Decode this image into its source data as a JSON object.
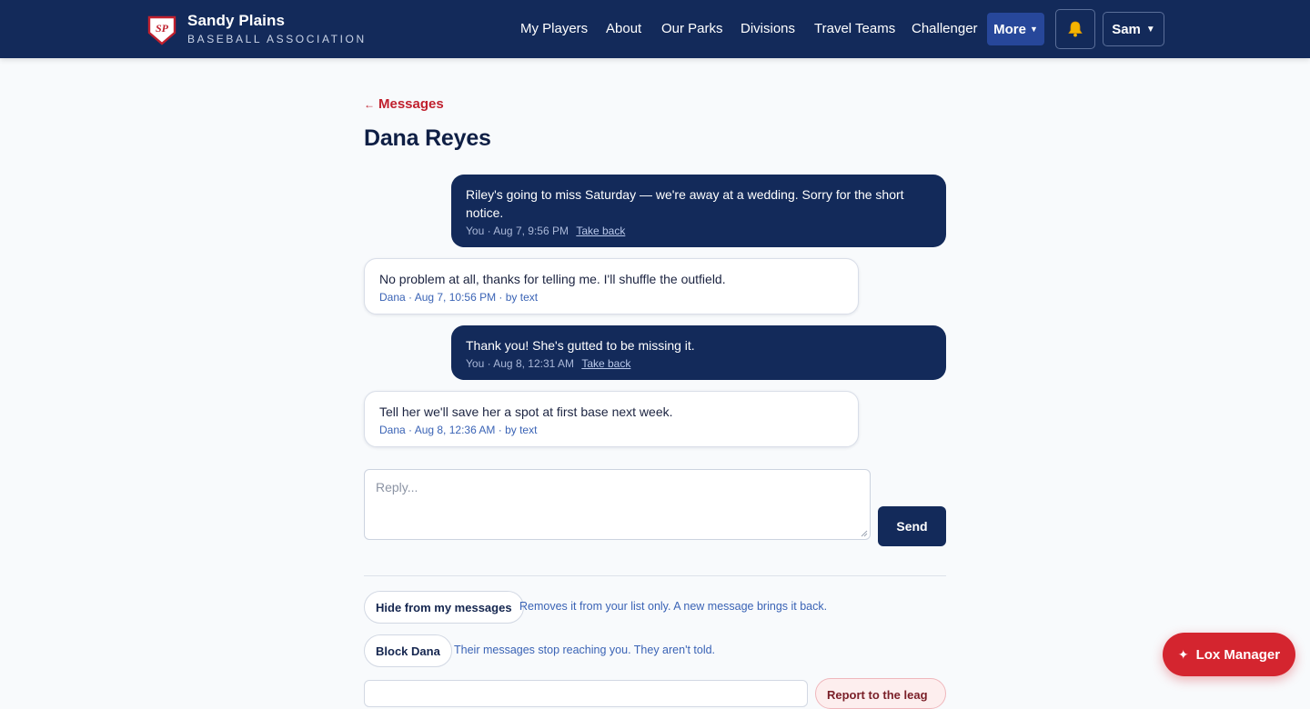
{
  "header": {
    "brand_title": "Sandy Plains",
    "brand_subtitle": "BASEBALL ASSOCIATION",
    "logo_initials": "SP",
    "nav": [
      "My Players",
      "About",
      "Our Parks",
      "Divisions",
      "Travel Teams",
      "Challenger"
    ],
    "more_label": "More",
    "user_label": "Sam",
    "bell_icon": "bell-icon"
  },
  "conversation": {
    "back_label": "Messages",
    "title": "Dana Reyes",
    "messages": [
      {
        "direction": "out",
        "text": "Riley's going to miss Saturday — we're away at a wedding. Sorry for the short notice.",
        "meta": "You · Aug 7, 9:56 PM",
        "action": "Take back"
      },
      {
        "direction": "in",
        "text": "No problem at all, thanks for telling me. I'll shuffle the outfield.",
        "meta": "Dana · Aug 7, 10:56 PM · by text"
      },
      {
        "direction": "out",
        "text": "Thank you! She's gutted to be missing it.",
        "meta": "You · Aug 8, 12:31 AM",
        "action": "Take back"
      },
      {
        "direction": "in",
        "text": "Tell her we'll save her a spot at first base next week.",
        "meta": "Dana · Aug 8, 12:36 AM · by text"
      }
    ]
  },
  "reply": {
    "placeholder": "Reply...",
    "send_label": "Send"
  },
  "options": {
    "hide_label": "Hide from my messages",
    "hide_note": "Removes it from your list only. A new message brings it back.",
    "block_label": "Block Dana",
    "block_note": "Their messages stop reaching you. They aren't told.",
    "report_label": "Report to the leag"
  },
  "assistant": {
    "label": "Lox Manager"
  },
  "colors": {
    "navy": "#132a5a",
    "accent_red": "#d4252f",
    "link_blue": "#3a63b5"
  }
}
